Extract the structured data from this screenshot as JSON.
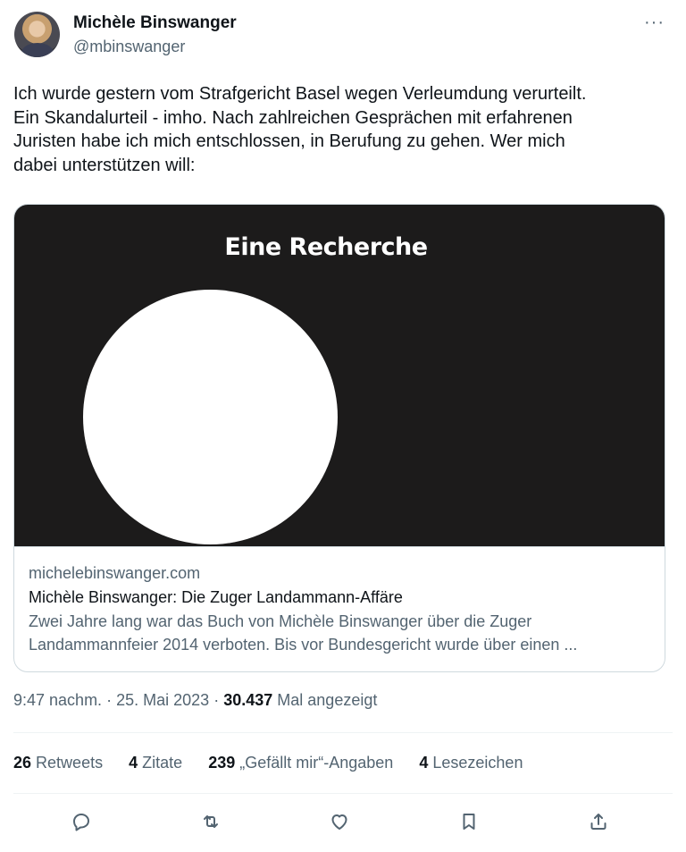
{
  "author": {
    "name": "Michèle Binswanger",
    "handle": "@mbinswanger",
    "more_icon": "more-horizontal-icon"
  },
  "tweet": {
    "text": "Ich wurde gestern vom Strafgericht Basel wegen Verleumdung verurteilt.\nEin Skandalurteil - imho. Nach zahlreichen Gesprächen mit erfahrenen\nJuristen habe ich mich entschlossen, in Berufung zu gehen. Wer mich\ndabei unterstützen will:"
  },
  "card": {
    "image_headline": "Eine Recherche",
    "domain": "michelebinswanger.com",
    "title": "Michèle Binswanger: Die Zuger Landammann-Affäre",
    "description_line1": "Zwei Jahre lang war das Buch von Michèle Binswanger über die Zuger",
    "description_line2": "Landammannfeier 2014 verboten. Bis vor Bundesgericht wurde über einen ..."
  },
  "meta": {
    "time": "9:47 nachm.",
    "separator": "·",
    "date": "25. Mai 2023",
    "views_count": "30.437",
    "views_label": "Mal angezeigt"
  },
  "stats": {
    "retweets_count": "26",
    "retweets_label": "Retweets",
    "quotes_count": "4",
    "quotes_label": "Zitate",
    "likes_count": "239",
    "likes_label": "„Gefällt mir“-Angaben",
    "bookmarks_count": "4",
    "bookmarks_label": "Lesezeichen"
  },
  "actions": [
    "reply-icon",
    "retweet-icon",
    "like-icon",
    "bookmark-icon",
    "share-icon"
  ]
}
